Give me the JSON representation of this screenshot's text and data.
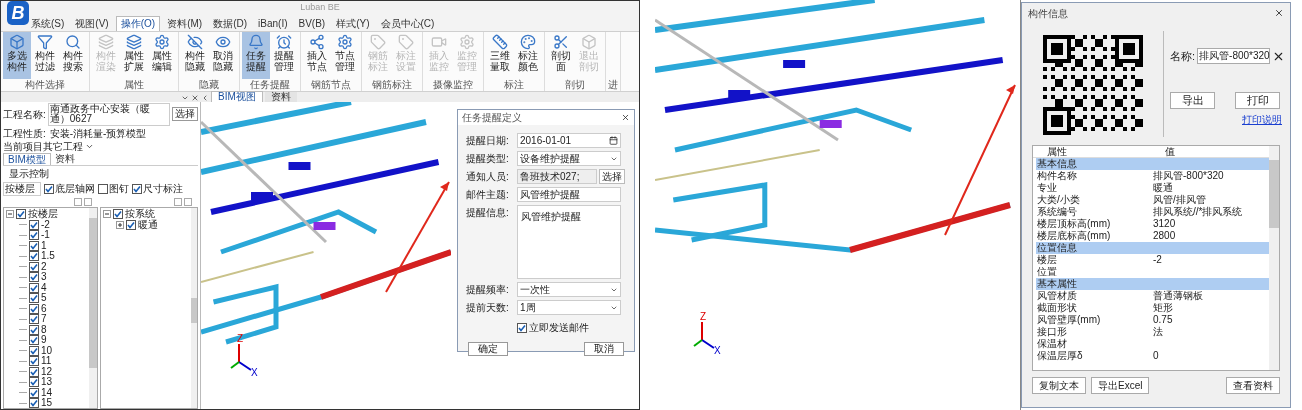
{
  "left_window": {
    "logo_letter": "B",
    "title": "Luban BE",
    "menu_tabs": [
      {
        "label": "系统(S)",
        "selected": false
      },
      {
        "label": "视图(V)",
        "selected": false
      },
      {
        "label": "操作(O)",
        "selected": true
      },
      {
        "label": "资料(M)",
        "selected": false
      },
      {
        "label": "数据(D)",
        "selected": false
      },
      {
        "label": "iBan(I)",
        "selected": false
      },
      {
        "label": "BV(B)",
        "selected": false
      },
      {
        "label": "样式(Y)",
        "selected": false
      },
      {
        "label": "会员中心(C)",
        "selected": false
      }
    ],
    "ribbon_groups": [
      {
        "label": "构件选择",
        "buttons": [
          {
            "label": "多选构件",
            "selected": true,
            "disabled": false
          },
          {
            "label": "构件过滤",
            "selected": false,
            "disabled": false
          },
          {
            "label": "构件搜索",
            "selected": false,
            "disabled": false
          }
        ]
      },
      {
        "label": "属性",
        "buttons": [
          {
            "label": "构件渲染",
            "selected": false,
            "disabled": true
          },
          {
            "label": "属性扩展",
            "selected": false,
            "disabled": false
          },
          {
            "label": "属性编辑",
            "selected": false,
            "disabled": false
          }
        ]
      },
      {
        "label": "隐藏",
        "buttons": [
          {
            "label": "构件隐藏",
            "selected": false,
            "disabled": false
          },
          {
            "label": "取消隐藏",
            "selected": false,
            "disabled": false
          }
        ]
      },
      {
        "label": "任务提醒",
        "buttons": [
          {
            "label": "任务提醒",
            "selected": true,
            "disabled": false
          },
          {
            "label": "提醒管理",
            "selected": false,
            "disabled": false
          }
        ]
      },
      {
        "label": "钢筋节点",
        "buttons": [
          {
            "label": "插入节点",
            "selected": false,
            "disabled": false
          },
          {
            "label": "节点管理",
            "selected": false,
            "disabled": false
          }
        ]
      },
      {
        "label": "钢筋标注",
        "buttons": [
          {
            "label": "钢筋标注",
            "selected": false,
            "disabled": true
          },
          {
            "label": "标注设置",
            "selected": false,
            "disabled": true
          }
        ]
      },
      {
        "label": "摄像监控",
        "buttons": [
          {
            "label": "插入监控",
            "selected": false,
            "disabled": true
          },
          {
            "label": "监控管理",
            "selected": false,
            "disabled": true
          }
        ]
      },
      {
        "label": "标注",
        "buttons": [
          {
            "label": "三维量取",
            "selected": false,
            "disabled": false
          },
          {
            "label": "标注颜色",
            "selected": false,
            "disabled": false
          }
        ]
      },
      {
        "label": "剖切",
        "buttons": [
          {
            "label": "剖切面",
            "selected": false,
            "disabled": false
          },
          {
            "label": "退出剖切",
            "selected": false,
            "disabled": true
          }
        ]
      },
      {
        "label": "进"
      }
    ],
    "doc_tabs": [
      {
        "label": "BIM视图",
        "selected": true
      },
      {
        "label": "资料",
        "selected": false
      }
    ],
    "panel": {
      "project_label": "工程名称:",
      "project_value": "南通政务中心安装（暖通）0627",
      "select_button": "选择",
      "nature_label": "工程性质:",
      "nature_value": "安装-消耗量-预算模型",
      "other_projects": "当前项目其它工程",
      "other_expanded": false,
      "tabs": [
        {
          "label": "BIM模型",
          "selected": true
        },
        {
          "label": "资料",
          "selected": false
        }
      ],
      "display_control": "显示控制",
      "filter_value": "按楼层",
      "options": [
        {
          "label": "底层轴网",
          "checked": true
        },
        {
          "label": "图钉",
          "checked": false
        },
        {
          "label": "尺寸标注",
          "checked": true
        }
      ],
      "floor_tree": [
        {
          "label": "按楼层",
          "checked": true,
          "expanded": true,
          "children": [
            {
              "label": "-2",
              "checked": true
            },
            {
              "label": "-1",
              "checked": true
            },
            {
              "label": "1",
              "checked": true
            },
            {
              "label": "1.5",
              "checked": true
            },
            {
              "label": "2",
              "checked": true
            },
            {
              "label": "3",
              "checked": true
            },
            {
              "label": "4",
              "checked": true
            },
            {
              "label": "5",
              "checked": true
            },
            {
              "label": "6",
              "checked": true
            },
            {
              "label": "7",
              "checked": true
            },
            {
              "label": "8",
              "checked": true
            },
            {
              "label": "9",
              "checked": true
            },
            {
              "label": "10",
              "checked": true
            },
            {
              "label": "11",
              "checked": true
            },
            {
              "label": "12",
              "checked": true
            },
            {
              "label": "13",
              "checked": true
            },
            {
              "label": "14",
              "checked": true
            },
            {
              "label": "15",
              "checked": true
            }
          ]
        }
      ],
      "system_tree": [
        {
          "label": "按系统",
          "checked": true,
          "expanded": true,
          "children": [
            {
              "label": "暖通",
              "checked": true,
              "expanded": false
            }
          ]
        }
      ]
    },
    "reminder_dialog": {
      "title": "任务提醒定义",
      "fields": [
        {
          "kind": "date",
          "label": "提醒日期:",
          "value": "2016-01-01"
        },
        {
          "kind": "select",
          "label": "提醒类型:",
          "value": "设备维护提醒"
        },
        {
          "kind": "picker",
          "label": "通知人员:",
          "value": "鲁班技术027;",
          "button": "选择"
        },
        {
          "kind": "text",
          "label": "邮件主题:",
          "value": "风管维护提醒"
        },
        {
          "kind": "textarea",
          "label": "提醒信息:",
          "value": "风管维护提醒"
        },
        {
          "kind": "select",
          "label": "提醒频率:",
          "value": "一次性"
        },
        {
          "kind": "select",
          "label": "提前天数:",
          "value": "1周"
        }
      ],
      "send_now": {
        "label": "立即发送邮件",
        "checked": true
      },
      "buttons": [
        "确定",
        "取消"
      ]
    },
    "axis_labels": [
      "Z",
      "X"
    ]
  },
  "right_window": {
    "axis_labels": [
      "Z",
      "X"
    ],
    "component_info": {
      "title": "构件信息",
      "name_label": "名称:",
      "name_value": "排风管-800*320",
      "buttons": [
        "导出",
        "打印"
      ],
      "help_link": "打印说明",
      "columns": [
        "属性",
        "值"
      ],
      "rows": [
        {
          "kind": "section",
          "name": "基本信息"
        },
        {
          "kind": "row",
          "name": "构件名称",
          "value": "排风管-800*320"
        },
        {
          "kind": "row",
          "name": "专业",
          "value": "暖通"
        },
        {
          "kind": "row",
          "name": "大类/小类",
          "value": "风管/排风管"
        },
        {
          "kind": "row",
          "name": "系统编号",
          "value": "排风系统//*排风系统"
        },
        {
          "kind": "row",
          "name": "楼层顶标高(mm)",
          "value": "3120"
        },
        {
          "kind": "row",
          "name": "楼层底标高(mm)",
          "value": "2800"
        },
        {
          "kind": "section",
          "name": "位置信息"
        },
        {
          "kind": "row",
          "name": "楼层",
          "value": "-2"
        },
        {
          "kind": "row",
          "name": "位置"
        },
        {
          "kind": "section",
          "name": "基本属性"
        },
        {
          "kind": "row",
          "name": "风管材质",
          "value": "普通薄钢板"
        },
        {
          "kind": "row",
          "name": "截面形状",
          "value": "矩形"
        },
        {
          "kind": "row",
          "name": "风管壁厚(mm)",
          "value": "0.75"
        },
        {
          "kind": "row",
          "name": "接口形",
          "value": "法"
        },
        {
          "kind": "row",
          "name": "保温材"
        },
        {
          "kind": "row",
          "name": "保温层厚δ",
          "value": "0"
        }
      ],
      "footer_buttons": [
        "复制文本",
        "导出Excel",
        "查看资料"
      ]
    }
  }
}
